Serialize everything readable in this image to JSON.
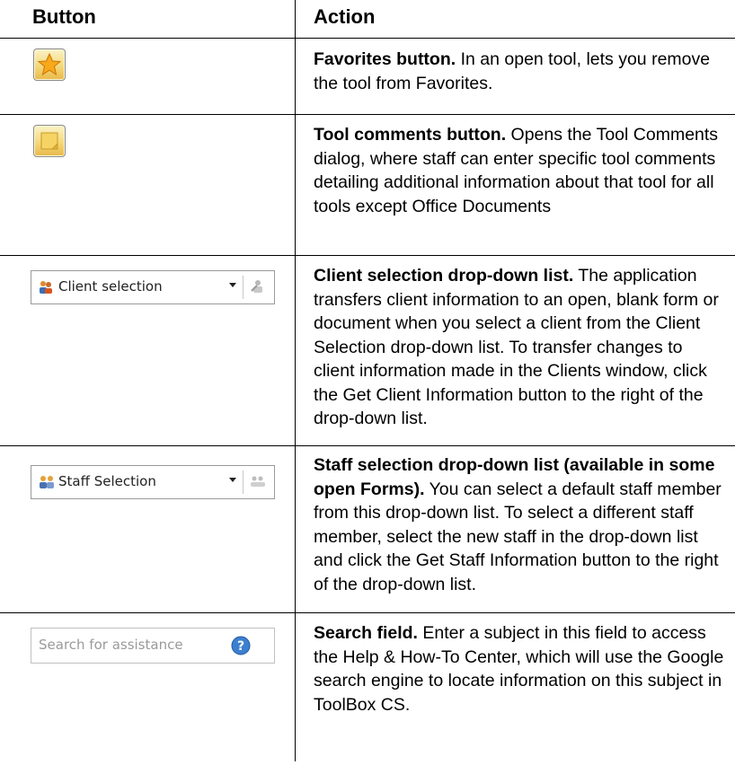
{
  "header": {
    "col_button": "Button",
    "col_action": "Action"
  },
  "rows": [
    {
      "control": {
        "type": "icon-button",
        "icon": "star-icon"
      },
      "title": "Favorites button.",
      "description": " In an open tool, lets you remove the tool from Favorites."
    },
    {
      "control": {
        "type": "icon-button",
        "icon": "sticky-note-icon"
      },
      "title": "Tool comments button.",
      "description": " Opens the Tool Comments dialog, where staff can enter specific tool comments detailing additional information about that tool for all tools except Office Documents"
    },
    {
      "control": {
        "type": "combo",
        "icon": "client-icon",
        "label": "Client selection"
      },
      "title": "Client selection drop-down list.",
      "description": " The application transfers client information to an open, blank form or document when you select a client from the Client Selection drop-down list. To transfer changes to client information made in the Clients window, click the Get Client Information button to the right of the drop-down list."
    },
    {
      "control": {
        "type": "combo",
        "icon": "staff-icon",
        "label": "Staff Selection"
      },
      "title": "Staff selection drop-down list (available in some open Forms).",
      "description": " You can select a default staff member from this drop-down list. To select a different staff member, select the new staff in the drop-down list and click the Get Staff Information button to the right of the drop-down list."
    },
    {
      "control": {
        "type": "search",
        "icon": "help-icon",
        "placeholder": "Search for assistance"
      },
      "title": "Search field.",
      "description": " Enter a subject in this field to access the Help & How-To Center, which will use the Google search engine to locate information on this subject in ToolBox CS."
    }
  ]
}
